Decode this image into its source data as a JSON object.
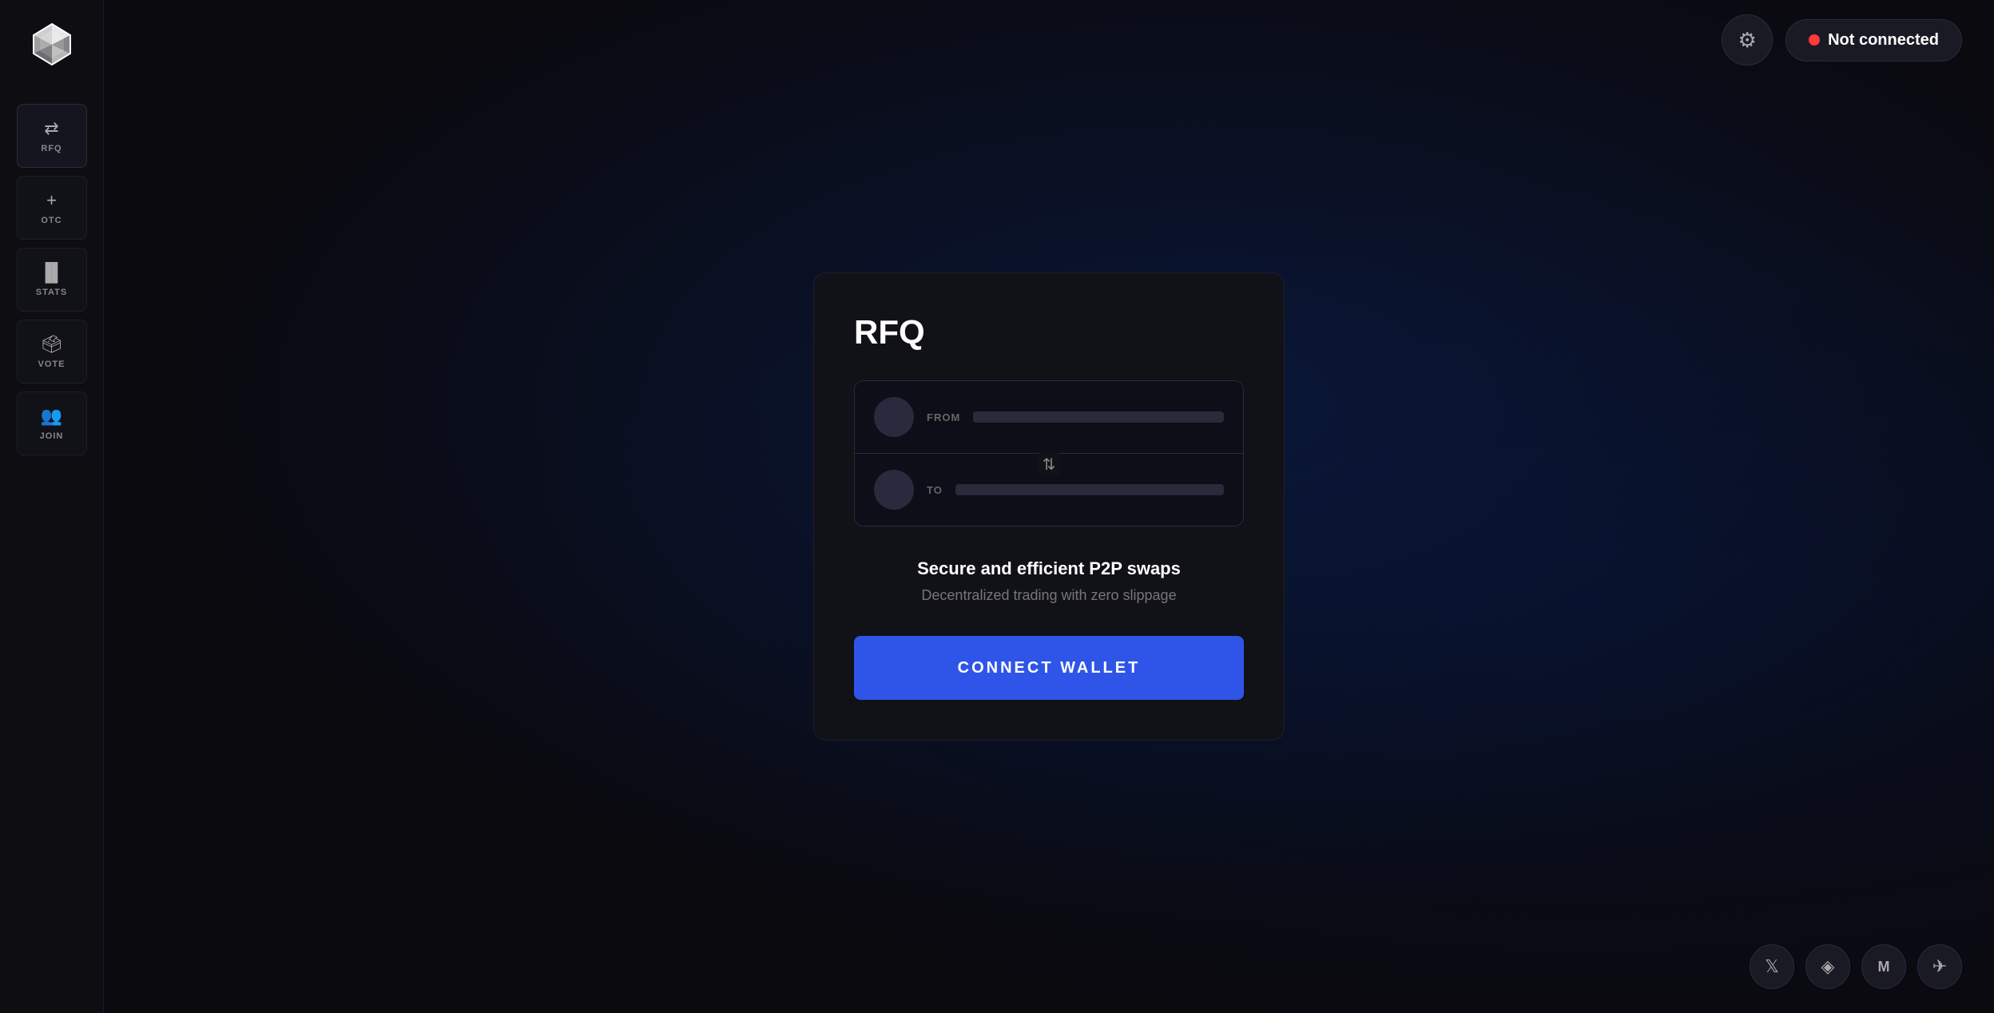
{
  "app": {
    "logo_alt": "Airswap logo"
  },
  "sidebar": {
    "items": [
      {
        "id": "rfq",
        "label": "RFQ",
        "icon": "⇄",
        "active": true
      },
      {
        "id": "otc",
        "label": "OTC",
        "icon": "+",
        "active": false
      },
      {
        "id": "stats",
        "label": "STATS",
        "icon": "📊",
        "active": false
      },
      {
        "id": "vote",
        "label": "VOTE",
        "icon": "🗳",
        "active": false
      },
      {
        "id": "join",
        "label": "JOIN",
        "icon": "👥",
        "active": false
      }
    ]
  },
  "header": {
    "settings_aria": "Settings",
    "wallet_status": "Not connected",
    "status_dot_color": "#ff3a3a"
  },
  "rfq": {
    "title": "RFQ",
    "from_label": "FROM",
    "to_label": "TO",
    "swap_icon": "⇅",
    "promo_title": "Secure and efficient P2P swaps",
    "promo_subtitle": "Decentralized trading with zero slippage",
    "connect_btn_label": "CONNECT WALLET"
  },
  "socials": [
    {
      "id": "twitter",
      "icon": "𝕏",
      "label": "Twitter"
    },
    {
      "id": "discord",
      "icon": "💬",
      "label": "Discord"
    },
    {
      "id": "medium",
      "icon": "M",
      "label": "Medium"
    },
    {
      "id": "telegram",
      "icon": "✈",
      "label": "Telegram"
    }
  ]
}
